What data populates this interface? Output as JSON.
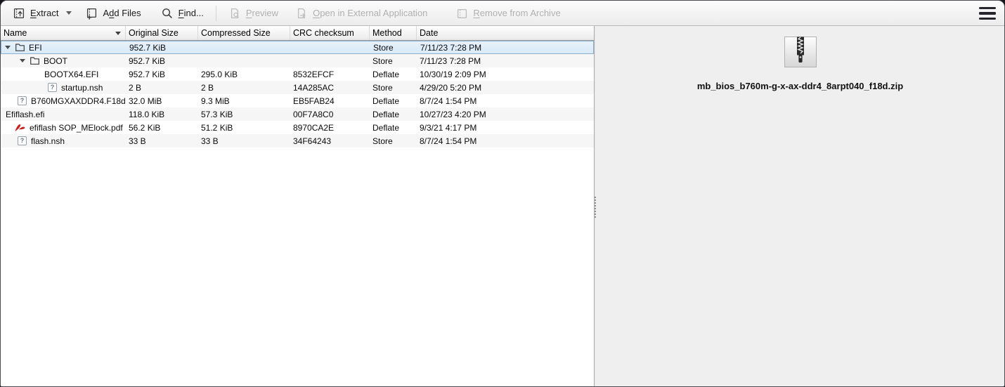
{
  "colors": {
    "selection_bg": "#d9eaf8",
    "selection_border": "#8cb0cf",
    "row_alt_bg": "#f6f6f6",
    "panel_bg": "#efefef",
    "toolbar_disabled_text": "#b0b0b0",
    "pdf_icon_red": "#c5221f"
  },
  "toolbar": {
    "extract": {
      "pre": "",
      "key": "E",
      "post": "xtract"
    },
    "add_files": {
      "pre": "A",
      "key": "d",
      "post": "d Files"
    },
    "find": {
      "pre": "",
      "key": "F",
      "post": "ind..."
    },
    "preview": {
      "pre": "",
      "key": "P",
      "post": "review"
    },
    "open_external": {
      "pre": "",
      "key": "O",
      "post": "pen in External Application"
    },
    "remove": {
      "pre": "",
      "key": "R",
      "post": "emove from Archive"
    }
  },
  "table": {
    "columns": {
      "name": "Name",
      "original_size": "Original Size",
      "compressed_size": "Compressed Size",
      "crc": "CRC checksum",
      "method": "Method",
      "date": "Date"
    },
    "sort": {
      "column": "Name",
      "direction": "descending"
    },
    "rows": [
      {
        "name": "EFI",
        "icon": "folder",
        "expanded": true,
        "selected": true,
        "original_size": "952.7 KiB",
        "compressed_size": "",
        "crc": "",
        "method": "Store",
        "date": "7/11/23 7:28 PM"
      },
      {
        "name": "BOOT",
        "icon": "folder",
        "expanded": true,
        "original_size": "952.7 KiB",
        "compressed_size": "",
        "crc": "",
        "method": "Store",
        "date": "7/11/23 7:28 PM"
      },
      {
        "name": "BOOTX64.EFI",
        "icon": "none",
        "original_size": "952.7 KiB",
        "compressed_size": "295.0 KiB",
        "crc": "8532EFCF",
        "method": "Deflate",
        "date": "10/30/19 2:09 PM"
      },
      {
        "name": "startup.nsh",
        "icon": "unknown",
        "original_size": "2 B",
        "compressed_size": "2 B",
        "crc": "14A285AC",
        "method": "Store",
        "date": "4/29/20 5:20 PM"
      },
      {
        "name": "B760MGXAXDDR4.F18d",
        "icon": "unknown",
        "original_size": "32.0 MiB",
        "compressed_size": "9.3 MiB",
        "crc": "EB5FAB24",
        "method": "Deflate",
        "date": "8/7/24 1:54 PM"
      },
      {
        "name": "Efiflash.efi",
        "icon": "none",
        "original_size": "118.0 KiB",
        "compressed_size": "57.3 KiB",
        "crc": "00F7A8C0",
        "method": "Deflate",
        "date": "10/27/23 4:20 PM"
      },
      {
        "name": "efiflash SOP_MElock.pdf",
        "icon": "pdf",
        "original_size": "56.2 KiB",
        "compressed_size": "51.2 KiB",
        "crc": "8970CA2E",
        "method": "Deflate",
        "date": "9/3/21 4:17 PM"
      },
      {
        "name": "flash.nsh",
        "icon": "unknown",
        "original_size": "33 B",
        "compressed_size": "33 B",
        "crc": "34F64243",
        "method": "Store",
        "date": "8/7/24 1:54 PM"
      }
    ]
  },
  "info_panel": {
    "icon": "zip-archive-icon",
    "archive_name": "mb_bios_b760m-g-x-ax-ddr4_8arpt040_f18d.zip"
  }
}
